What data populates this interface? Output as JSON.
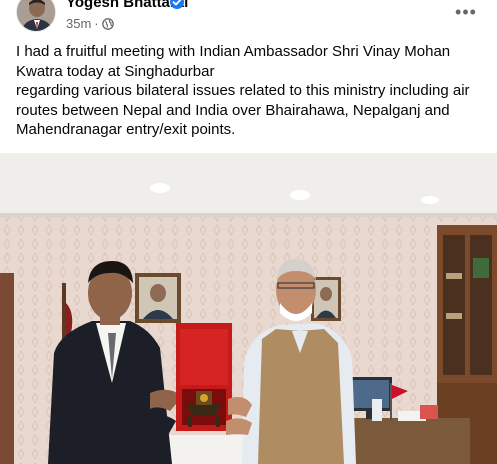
{
  "post": {
    "author": "Yogesh Bhattarai",
    "verified": true,
    "time": "35m",
    "dot": "·",
    "privacy_icon": "globe-icon",
    "more_icon": "more-horizontal-icon",
    "more_label": "•••",
    "text_line1": "I had a fruitful meeting with Indian Ambassador Shri Vinay Mohan Kwatra today at Singhadurbar",
    "text_line2": "regarding various bilateral issues related to this ministry including air routes between Nepal and India over Bhairahawa, Nepalganj and Mahendranagar entry/exit points."
  },
  "colors": {
    "accent": "#1877f2",
    "meta": "#65676b",
    "text": "#050505"
  }
}
